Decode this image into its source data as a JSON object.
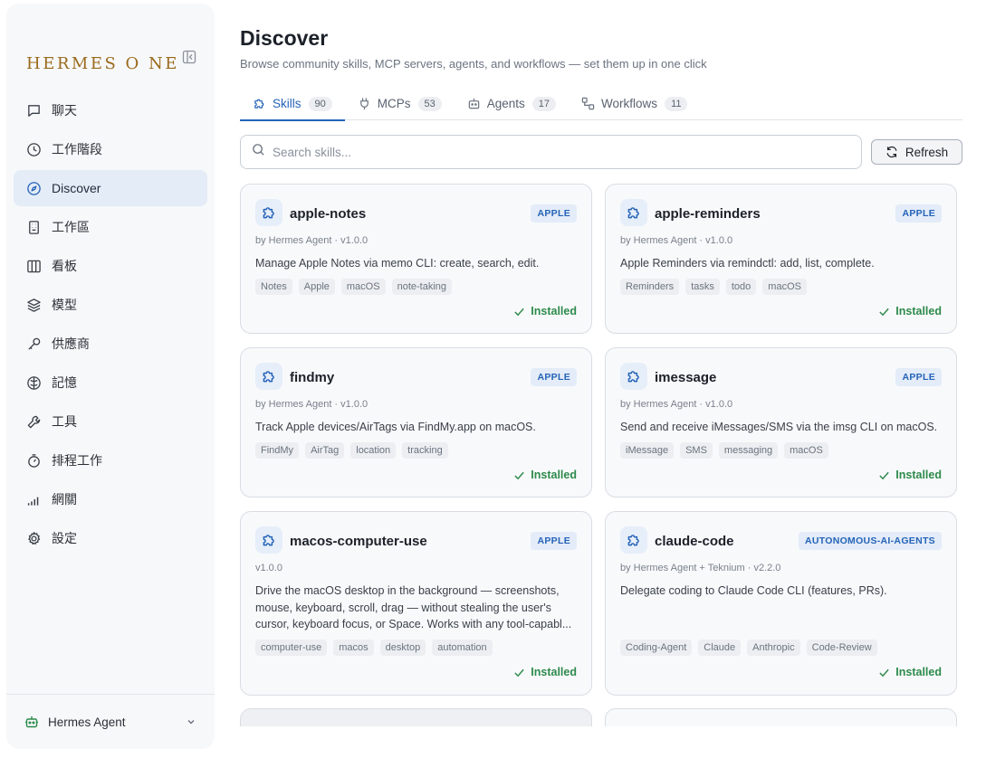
{
  "sidebar": {
    "logo": "HERMES O NE",
    "items": [
      {
        "label": "聊天",
        "icon": "chat-icon"
      },
      {
        "label": "工作階段",
        "icon": "clock-icon"
      },
      {
        "label": "Discover",
        "icon": "compass-icon",
        "active": true
      },
      {
        "label": "工作區",
        "icon": "building-icon"
      },
      {
        "label": "看板",
        "icon": "kanban-icon"
      },
      {
        "label": "模型",
        "icon": "layers-icon"
      },
      {
        "label": "供應商",
        "icon": "key-icon"
      },
      {
        "label": "記憶",
        "icon": "brain-icon"
      },
      {
        "label": "工具",
        "icon": "wrench-icon"
      },
      {
        "label": "排程工作",
        "icon": "timer-icon"
      },
      {
        "label": "網關",
        "icon": "signal-icon"
      },
      {
        "label": "設定",
        "icon": "gear-icon"
      }
    ],
    "footer_label": "Hermes Agent"
  },
  "header": {
    "title": "Discover",
    "subtitle": "Browse community skills, MCP servers, agents, and workflows — set them up in one click"
  },
  "tabs": [
    {
      "label": "Skills",
      "count": "90",
      "icon": "puzzle-icon",
      "active": true
    },
    {
      "label": "MCPs",
      "count": "53",
      "icon": "plug-icon"
    },
    {
      "label": "Agents",
      "count": "17",
      "icon": "robot-icon"
    },
    {
      "label": "Workflows",
      "count": "11",
      "icon": "workflow-icon"
    }
  ],
  "search": {
    "placeholder": "Search skills..."
  },
  "refresh_label": "Refresh",
  "cards": [
    {
      "name": "apple-notes",
      "category": "APPLE",
      "meta": "by Hermes Agent · v1.0.0",
      "description": "Manage Apple Notes via memo CLI: create, search, edit.",
      "tags": [
        "Notes",
        "Apple",
        "macOS",
        "note-taking"
      ],
      "status": "Installed"
    },
    {
      "name": "apple-reminders",
      "category": "APPLE",
      "meta": "by Hermes Agent · v1.0.0",
      "description": "Apple Reminders via remindctl: add, list, complete.",
      "tags": [
        "Reminders",
        "tasks",
        "todo",
        "macOS"
      ],
      "status": "Installed"
    },
    {
      "name": "findmy",
      "category": "APPLE",
      "meta": "by Hermes Agent · v1.0.0",
      "description": "Track Apple devices/AirTags via FindMy.app on macOS.",
      "tags": [
        "FindMy",
        "AirTag",
        "location",
        "tracking"
      ],
      "status": "Installed"
    },
    {
      "name": "imessage",
      "category": "APPLE",
      "meta": "by Hermes Agent · v1.0.0",
      "description": "Send and receive iMessages/SMS via the imsg CLI on macOS.",
      "tags": [
        "iMessage",
        "SMS",
        "messaging",
        "macOS"
      ],
      "status": "Installed"
    },
    {
      "name": "macos-computer-use",
      "category": "APPLE",
      "meta": "v1.0.0",
      "description": "Drive the macOS desktop in the background — screenshots, mouse, keyboard, scroll, drag — without stealing the user's cursor, keyboard focus, or Space. Works with any tool-capabl...",
      "tags": [
        "computer-use",
        "macos",
        "desktop",
        "automation"
      ],
      "status": "Installed"
    },
    {
      "name": "claude-code",
      "category": "AUTONOMOUS-AI-AGENTS",
      "meta": "by Hermes Agent + Teknium · v2.2.0",
      "description": "Delegate coding to Claude Code CLI (features, PRs).",
      "tags": [
        "Coding-Agent",
        "Claude",
        "Anthropic",
        "Code-Review"
      ],
      "status": "Installed"
    }
  ],
  "colors": {
    "accent": "#2563b8",
    "installed": "#2d8a4b",
    "logo": "#9a6a1c",
    "active_nav_bg": "#e4ecf7"
  }
}
